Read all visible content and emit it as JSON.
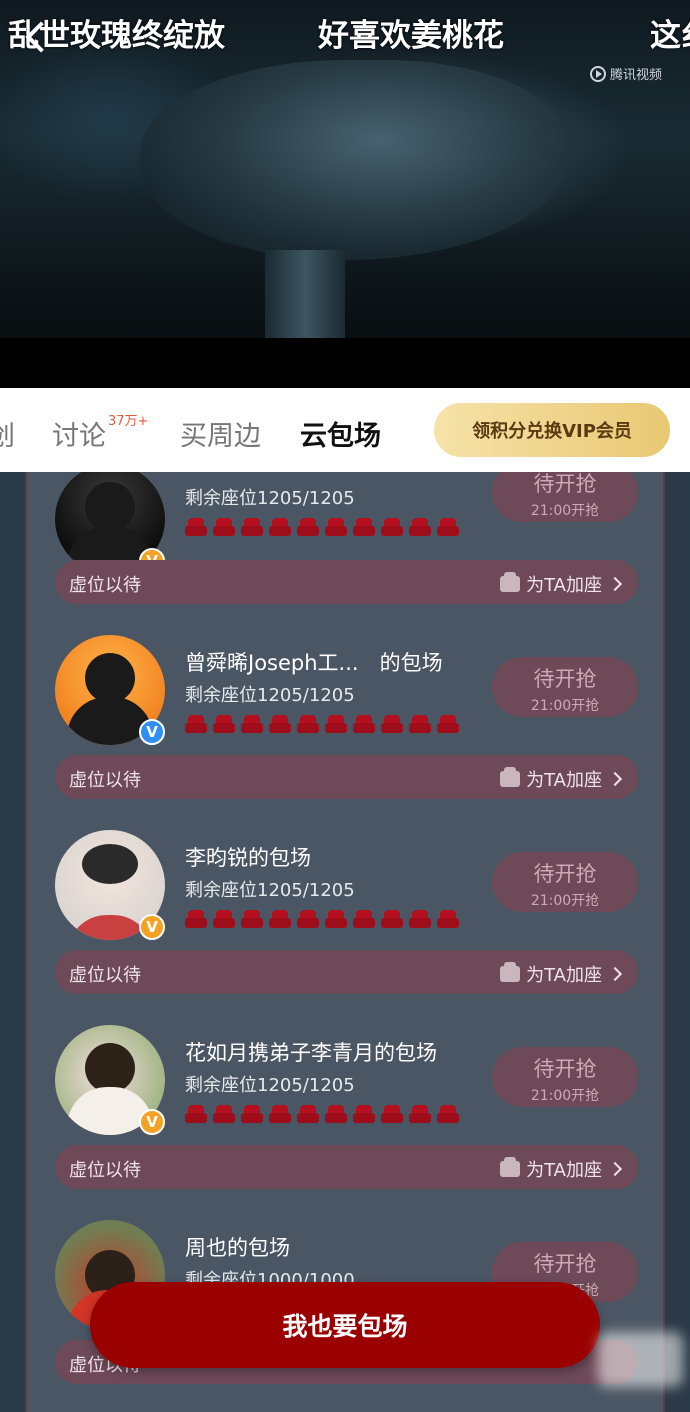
{
  "danmaku": [
    "乱世玫瑰终绽放",
    "好喜欢姜桃花",
    "这纟"
  ],
  "watermark": "腾讯视频",
  "tabs": {
    "partial": "创",
    "discuss": "讨论",
    "discuss_badge": "37万+",
    "merch": "买周边",
    "cloud": "云包场",
    "vip_button": "领积分兑换VIP会员"
  },
  "cards": [
    {
      "title": "",
      "seats": "剩余座位1205/1205",
      "status": "待开抢",
      "time": "21:00开抢",
      "bar_left": "虚位以待",
      "bar_right": "为TA加座",
      "badge": "orange"
    },
    {
      "title": "曾舜晞Joseph工...　的包场",
      "seats": "剩余座位1205/1205",
      "status": "待开抢",
      "time": "21:00开抢",
      "bar_left": "虚位以待",
      "bar_right": "为TA加座",
      "badge": "blue"
    },
    {
      "title": "李昀锐的包场",
      "seats": "剩余座位1205/1205",
      "status": "待开抢",
      "time": "21:00开抢",
      "bar_left": "虚位以待",
      "bar_right": "为TA加座",
      "badge": "orange"
    },
    {
      "title": "花如月携弟子李青月的包场",
      "seats": "剩余座位1205/1205",
      "status": "待开抢",
      "time": "21:00开抢",
      "bar_left": "虚位以待",
      "bar_right": "为TA加座",
      "badge": "orange"
    },
    {
      "title": "周也的包场",
      "seats": "剩余座位1000/1000",
      "status": "待开抢",
      "time": "21:00开抢",
      "bar_left": "虚位以待",
      "bar_right": "",
      "badge": "orange"
    }
  ],
  "badge_letter": "V",
  "cta": "我也要包场"
}
